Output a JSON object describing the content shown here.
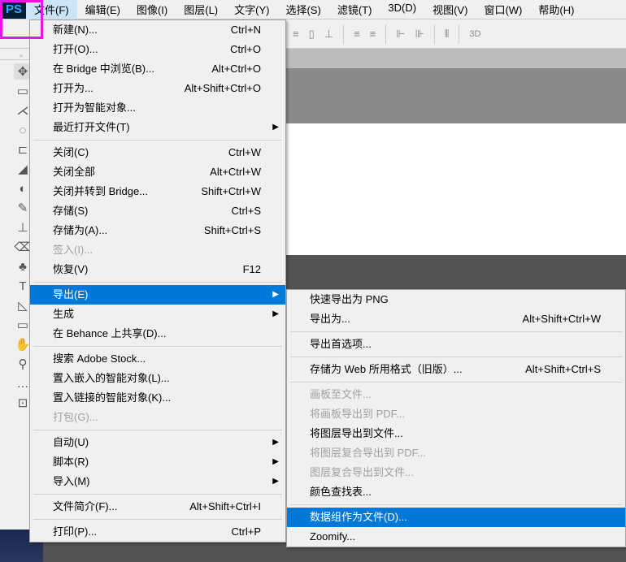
{
  "logo": "PS",
  "menubar": [
    "文件(F)",
    "编辑(E)",
    "图像(I)",
    "图层(L)",
    "文字(Y)",
    "选择(S)",
    "滤镜(T)",
    "3D(D)",
    "视图(V)",
    "窗口(W)",
    "帮助(H)"
  ],
  "toolbar_3d": "3D",
  "file_menu": [
    {
      "label": "新建(N)...",
      "sc": "Ctrl+N"
    },
    {
      "label": "打开(O)...",
      "sc": "Ctrl+O"
    },
    {
      "label": "在 Bridge 中浏览(B)...",
      "sc": "Alt+Ctrl+O"
    },
    {
      "label": "打开为...",
      "sc": "Alt+Shift+Ctrl+O"
    },
    {
      "label": "打开为智能对象..."
    },
    {
      "label": "最近打开文件(T)",
      "sub": true
    },
    {
      "sep": true
    },
    {
      "label": "关闭(C)",
      "sc": "Ctrl+W"
    },
    {
      "label": "关闭全部",
      "sc": "Alt+Ctrl+W"
    },
    {
      "label": "关闭并转到 Bridge...",
      "sc": "Shift+Ctrl+W"
    },
    {
      "label": "存储(S)",
      "sc": "Ctrl+S"
    },
    {
      "label": "存储为(A)...",
      "sc": "Shift+Ctrl+S"
    },
    {
      "label": "签入(I)...",
      "dis": true
    },
    {
      "label": "恢复(V)",
      "sc": "F12"
    },
    {
      "sep": true
    },
    {
      "label": "导出(E)",
      "sub": true,
      "hov": true
    },
    {
      "label": "生成",
      "sub": true
    },
    {
      "label": "在 Behance 上共享(D)..."
    },
    {
      "sep": true
    },
    {
      "label": "搜索 Adobe Stock..."
    },
    {
      "label": "置入嵌入的智能对象(L)..."
    },
    {
      "label": "置入链接的智能对象(K)..."
    },
    {
      "label": "打包(G)...",
      "dis": true
    },
    {
      "sep": true
    },
    {
      "label": "自动(U)",
      "sub": true
    },
    {
      "label": "脚本(R)",
      "sub": true
    },
    {
      "label": "导入(M)",
      "sub": true
    },
    {
      "sep": true
    },
    {
      "label": "文件简介(F)...",
      "sc": "Alt+Shift+Ctrl+I"
    },
    {
      "sep": true
    },
    {
      "label": "打印(P)...",
      "sc": "Ctrl+P"
    }
  ],
  "export_menu": [
    {
      "label": "快速导出为 PNG"
    },
    {
      "label": "导出为...",
      "sc": "Alt+Shift+Ctrl+W"
    },
    {
      "sep": true
    },
    {
      "label": "导出首选项..."
    },
    {
      "sep": true
    },
    {
      "label": "存储为 Web 所用格式（旧版）...",
      "sc": "Alt+Shift+Ctrl+S"
    },
    {
      "sep": true
    },
    {
      "label": "画板至文件...",
      "dis": true
    },
    {
      "label": "将画板导出到 PDF...",
      "dis": true
    },
    {
      "label": "将图层导出到文件..."
    },
    {
      "label": "将图层复合导出到 PDF...",
      "dis": true
    },
    {
      "label": "图层复合导出到文件...",
      "dis": true
    },
    {
      "label": "颜色查找表..."
    },
    {
      "sep": true
    },
    {
      "label": "数据组作为文件(D)...",
      "hov": true
    },
    {
      "label": "Zoomify..."
    }
  ]
}
